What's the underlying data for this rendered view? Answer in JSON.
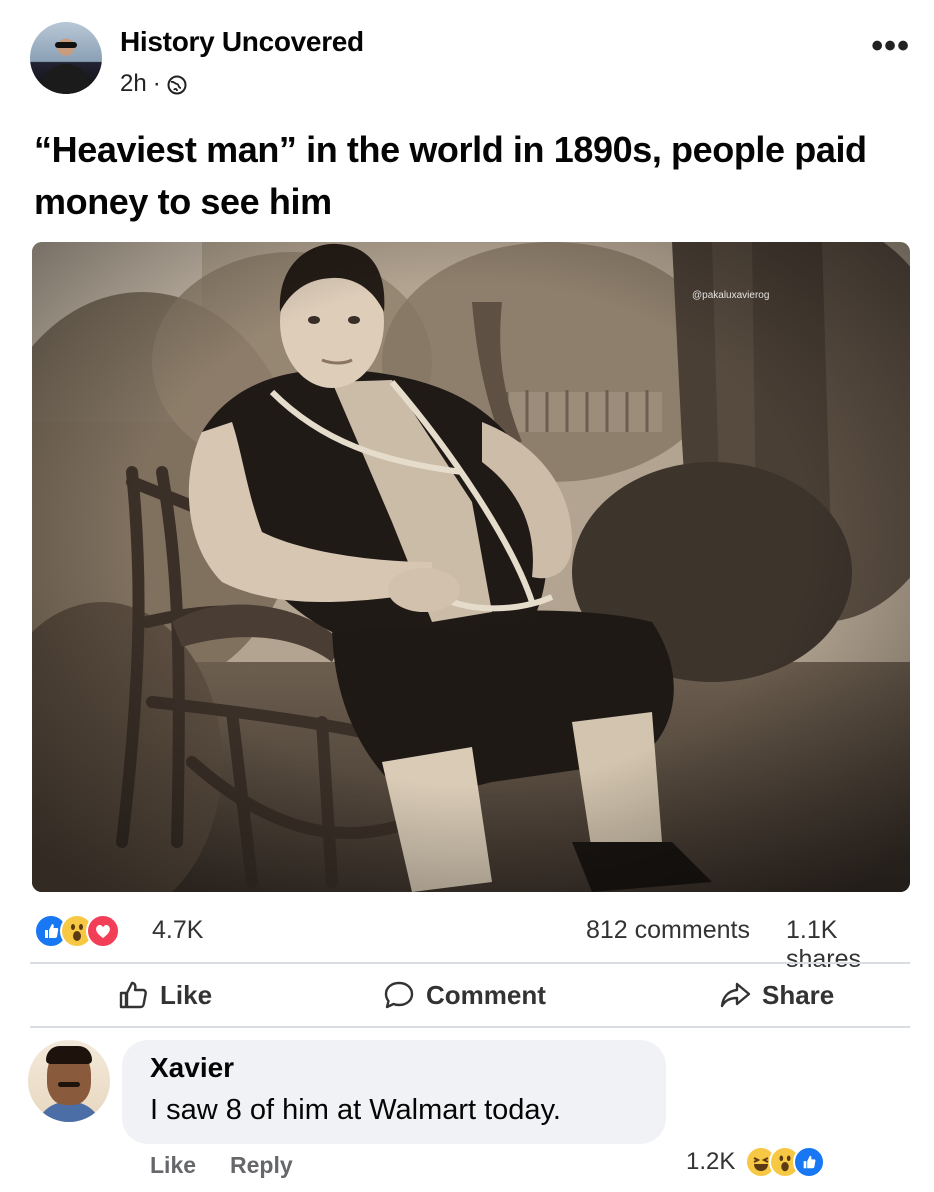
{
  "post": {
    "page_name": "History Uncovered",
    "time": "2h",
    "separator": "·",
    "privacy_icon": "globe-icon",
    "more_label": "•••",
    "text": "“Heaviest man” in the world in 1890s, people paid money to see him",
    "watermark": "@pakaluxavierog"
  },
  "stats": {
    "reaction_icons": [
      "like-icon",
      "wow-icon",
      "love-icon"
    ],
    "reactions": "4.7K",
    "comments": "812 comments",
    "shares": "1.1K shares"
  },
  "actions": {
    "like": "Like",
    "comment": "Comment",
    "share": "Share"
  },
  "comment": {
    "author": "Xavier",
    "text": "I saw 8 of him at Walmart today.",
    "like": "Like",
    "reply": "Reply",
    "reaction_count": "1.2K",
    "reaction_icons": [
      "haha-icon",
      "wow-icon",
      "like-icon"
    ]
  },
  "colors": {
    "like_blue": "#1877f2",
    "love_red": "#f33e58",
    "wow_yellow": "#f7c843",
    "secondary_text": "#65676b",
    "bubble_bg": "#f0f2f5"
  }
}
